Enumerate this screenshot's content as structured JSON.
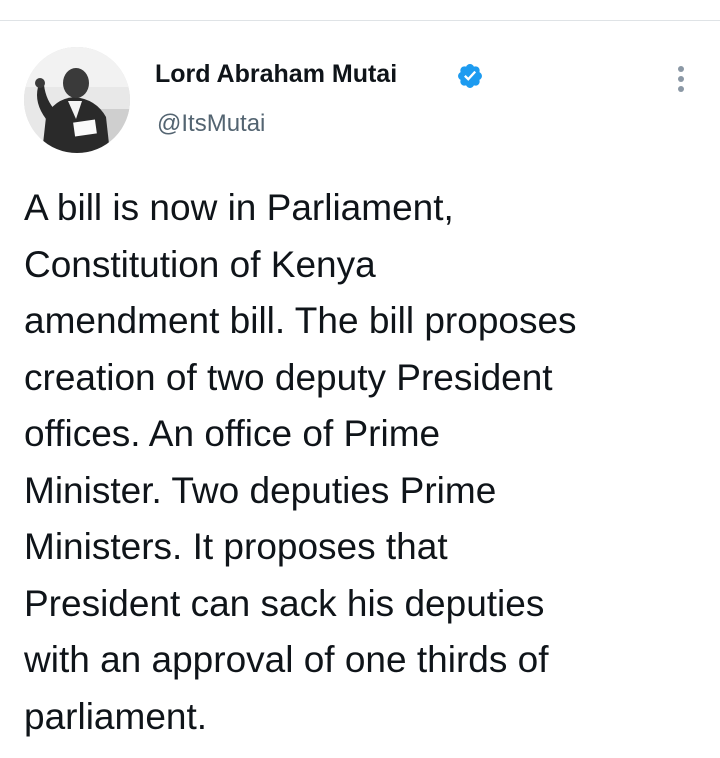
{
  "tweet": {
    "author": {
      "display_name": "Lord Abraham Mutai",
      "handle": "@ItsMutai",
      "verified": true,
      "verified_color": "#1d9bf0"
    },
    "icons": {
      "verified": "verified-badge-icon",
      "more": "more-options-icon",
      "avatar": "profile-photo"
    },
    "text_lines": [
      "A bill is now in Parliament,",
      "Constitution of Kenya",
      "amendment bill. The bill proposes",
      "creation of two deputy President",
      "offices. An office of Prime",
      "Minister. Two deputies Prime",
      "Ministers. It proposes that",
      "President can sack his deputies",
      "with an approval of one thirds of",
      "parliament."
    ]
  }
}
